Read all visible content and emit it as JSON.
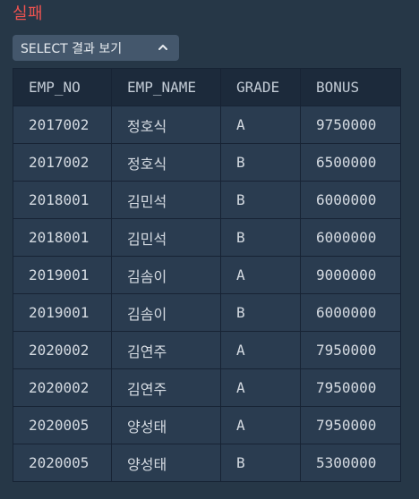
{
  "status": {
    "title": "실패"
  },
  "toggle": {
    "label": "SELECT 결과 보기",
    "icon": "chevron-up-icon"
  },
  "table": {
    "columns": [
      "EMP_NO",
      "EMP_NAME",
      "GRADE",
      "BONUS"
    ],
    "rows": [
      [
        "2017002",
        "정호식",
        "A",
        "9750000"
      ],
      [
        "2017002",
        "정호식",
        "B",
        "6500000"
      ],
      [
        "2018001",
        "김민석",
        "B",
        "6000000"
      ],
      [
        "2018001",
        "김민석",
        "B",
        "6000000"
      ],
      [
        "2019001",
        "김솜이",
        "A",
        "9000000"
      ],
      [
        "2019001",
        "김솜이",
        "B",
        "6000000"
      ],
      [
        "2020002",
        "김연주",
        "A",
        "7950000"
      ],
      [
        "2020002",
        "김연주",
        "A",
        "7950000"
      ],
      [
        "2020005",
        "양성태",
        "A",
        "7950000"
      ],
      [
        "2020005",
        "양성태",
        "B",
        "5300000"
      ]
    ]
  },
  "colors": {
    "background": "#263747",
    "error": "#ef5350",
    "button": "#44576c",
    "header": "#1c2a3b",
    "row": "#2a3c50"
  }
}
